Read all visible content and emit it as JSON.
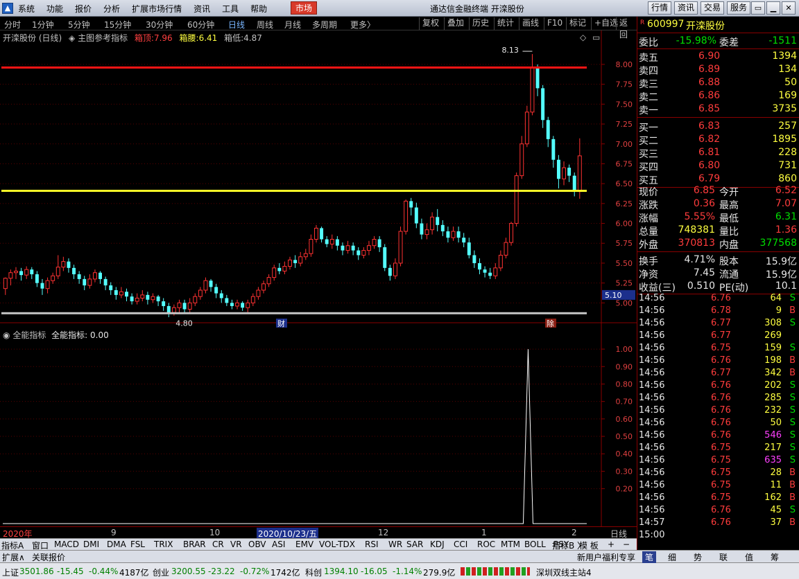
{
  "titlebar": {
    "menu": [
      "系统",
      "功能",
      "报价",
      "分析",
      "扩展市场行情",
      "资讯",
      "工具",
      "帮助"
    ],
    "market_label": "市场",
    "title": "通达信金融终端  开滦股份",
    "buttons": [
      "行情",
      "资讯",
      "交易",
      "服务"
    ]
  },
  "periodbar": {
    "periods": [
      "分时",
      "1分钟",
      "5分钟",
      "15分钟",
      "30分钟",
      "60分钟",
      "日线",
      "周线",
      "月线",
      "多周期",
      "更多〉"
    ],
    "active": "日线",
    "tools": [
      "复权",
      "叠加",
      "历史",
      "统计",
      "画线",
      "F10",
      "标记",
      "+自选",
      "返回"
    ]
  },
  "chartinfo": {
    "stock": "开滦股份 (日线)",
    "indicator": "主图参考指标",
    "top_label": "箱顶:",
    "top_value": "7.96",
    "mid_label": "箱腰:",
    "mid_value": "6.41",
    "bottom_label": "箱低:",
    "bottom_value": "4.87"
  },
  "chart_data": {
    "type": "candlestick",
    "y_axis_main": [
      "8.00",
      "7.75",
      "7.50",
      "7.25",
      "7.00",
      "6.75",
      "6.50",
      "6.25",
      "6.00",
      "5.75",
      "5.50",
      "5.25",
      "5.00"
    ],
    "ylim_main": [
      4.82,
      8.2
    ],
    "high_label": "8.13",
    "low_label": "4.80",
    "current_price_tag": "5.10",
    "box_top": 7.96,
    "box_mid": 6.41,
    "box_bottom": 4.87,
    "markers": [
      "财",
      "除"
    ],
    "candles": [
      [
        5.18,
        5.31,
        5.1,
        5.32
      ],
      [
        5.31,
        5.38,
        5.22,
        5.42
      ],
      [
        5.38,
        5.4,
        5.3,
        5.45
      ],
      [
        5.4,
        5.35,
        5.28,
        5.44
      ],
      [
        5.35,
        5.42,
        5.3,
        5.46
      ],
      [
        5.42,
        5.36,
        5.3,
        5.45
      ],
      [
        5.36,
        5.25,
        5.2,
        5.4
      ],
      [
        5.25,
        5.18,
        5.1,
        5.3
      ],
      [
        5.18,
        5.28,
        5.12,
        5.32
      ],
      [
        5.28,
        5.34,
        5.24,
        5.38
      ],
      [
        5.34,
        5.45,
        5.3,
        5.6
      ],
      [
        5.45,
        5.52,
        5.4,
        5.58
      ],
      [
        5.52,
        5.44,
        5.38,
        5.56
      ],
      [
        5.44,
        5.36,
        5.3,
        5.48
      ],
      [
        5.36,
        5.3,
        5.24,
        5.4
      ],
      [
        5.3,
        5.22,
        5.16,
        5.34
      ],
      [
        5.22,
        5.3,
        5.18,
        5.36
      ],
      [
        5.3,
        5.38,
        5.26,
        5.42
      ],
      [
        5.38,
        5.3,
        5.24,
        5.4
      ],
      [
        5.3,
        5.22,
        5.16,
        5.33
      ],
      [
        5.22,
        5.16,
        5.1,
        5.26
      ],
      [
        5.16,
        5.1,
        5.04,
        5.2
      ],
      [
        5.1,
        5.14,
        5.06,
        5.2
      ],
      [
        5.14,
        5.08,
        5.02,
        5.18
      ],
      [
        5.08,
        5.02,
        4.98,
        5.12
      ],
      [
        5.02,
        5.06,
        4.98,
        5.12
      ],
      [
        5.06,
        5.1,
        5.02,
        5.16
      ],
      [
        5.1,
        5.04,
        4.98,
        5.14
      ],
      [
        5.04,
        5.08,
        5.0,
        5.12
      ],
      [
        5.08,
        5.02,
        4.96,
        5.1
      ],
      [
        5.02,
        4.96,
        4.9,
        5.06
      ],
      [
        4.96,
        4.88,
        4.82,
        5.0
      ],
      [
        4.88,
        4.94,
        4.84,
        4.98
      ],
      [
        4.94,
        5.0,
        4.88,
        5.04
      ],
      [
        5.0,
        4.92,
        4.86,
        5.04
      ],
      [
        4.92,
        5.0,
        4.88,
        5.06
      ],
      [
        5.0,
        5.08,
        4.96,
        5.12
      ],
      [
        5.08,
        5.16,
        5.04,
        5.2
      ],
      [
        5.16,
        5.28,
        5.12,
        5.32
      ],
      [
        5.28,
        5.2,
        5.14,
        5.3
      ],
      [
        5.2,
        5.12,
        5.06,
        5.24
      ],
      [
        5.12,
        5.06,
        5.0,
        5.16
      ],
      [
        5.06,
        5.0,
        4.96,
        5.1
      ],
      [
        5.0,
        4.96,
        4.92,
        5.04
      ],
      [
        4.96,
        5.0,
        4.92,
        5.04
      ],
      [
        5.0,
        4.94,
        4.9,
        5.02
      ],
      [
        4.94,
        5.0,
        4.88,
        5.04
      ],
      [
        5.0,
        5.08,
        4.96,
        5.12
      ],
      [
        5.08,
        5.16,
        5.04,
        5.2
      ],
      [
        5.16,
        5.24,
        5.12,
        5.28
      ],
      [
        5.24,
        5.32,
        5.2,
        5.36
      ],
      [
        5.32,
        5.44,
        5.28,
        5.48
      ],
      [
        5.44,
        5.4,
        5.36,
        5.5
      ],
      [
        5.4,
        5.46,
        5.36,
        5.52
      ],
      [
        5.46,
        5.54,
        5.42,
        5.58
      ],
      [
        5.54,
        5.5,
        5.44,
        5.6
      ],
      [
        5.5,
        5.58,
        5.46,
        5.64
      ],
      [
        5.58,
        5.62,
        5.54,
        5.68
      ],
      [
        5.62,
        5.8,
        5.58,
        5.86
      ],
      [
        5.8,
        5.94,
        5.76,
        5.98
      ],
      [
        5.94,
        5.8,
        5.76,
        5.96
      ],
      [
        5.8,
        5.74,
        5.7,
        5.84
      ],
      [
        5.74,
        5.8,
        5.68,
        5.86
      ],
      [
        5.8,
        5.72,
        5.66,
        5.84
      ],
      [
        5.72,
        5.66,
        5.6,
        5.76
      ],
      [
        5.66,
        5.72,
        5.62,
        5.78
      ],
      [
        5.72,
        5.66,
        5.6,
        5.76
      ],
      [
        5.66,
        5.6,
        5.54,
        5.7
      ],
      [
        5.6,
        5.66,
        5.56,
        5.7
      ],
      [
        5.66,
        5.72,
        5.6,
        5.78
      ],
      [
        5.72,
        5.8,
        5.68,
        5.84
      ],
      [
        5.8,
        5.7,
        5.64,
        5.84
      ],
      [
        5.7,
        5.44,
        5.4,
        5.74
      ],
      [
        5.44,
        5.34,
        5.28,
        5.48
      ],
      [
        5.34,
        5.5,
        5.3,
        5.56
      ],
      [
        5.5,
        5.9,
        5.46,
        5.96
      ],
      [
        5.9,
        6.28,
        5.86,
        6.3
      ],
      [
        6.28,
        6.2,
        6.1,
        6.32
      ],
      [
        6.2,
        6.0,
        5.94,
        6.26
      ],
      [
        6.0,
        5.86,
        5.8,
        6.06
      ],
      [
        5.86,
        5.92,
        5.8,
        6.0
      ],
      [
        5.92,
        6.08,
        5.86,
        6.14
      ],
      [
        6.08,
        5.98,
        5.9,
        6.18
      ],
      [
        5.98,
        5.9,
        5.84,
        6.04
      ],
      [
        5.9,
        5.82,
        5.76,
        5.96
      ],
      [
        5.82,
        5.9,
        5.78,
        5.96
      ],
      [
        5.9,
        5.82,
        5.76,
        5.96
      ],
      [
        5.82,
        5.76,
        5.7,
        5.88
      ],
      [
        5.76,
        5.6,
        5.56,
        5.82
      ],
      [
        5.6,
        5.5,
        5.44,
        5.66
      ],
      [
        5.5,
        5.42,
        5.36,
        5.56
      ],
      [
        5.42,
        5.38,
        5.32,
        5.46
      ],
      [
        5.38,
        5.34,
        5.3,
        5.44
      ],
      [
        5.34,
        5.44,
        5.3,
        5.5
      ],
      [
        5.44,
        5.6,
        5.4,
        5.66
      ],
      [
        5.6,
        5.76,
        5.56,
        5.82
      ],
      [
        5.76,
        6.0,
        5.72,
        6.02
      ],
      [
        6.0,
        6.6,
        5.96,
        6.64
      ],
      [
        6.6,
        7.0,
        6.56,
        7.1
      ],
      [
        7.0,
        7.4,
        6.96,
        7.48
      ],
      [
        7.4,
        7.96,
        7.36,
        8.13
      ],
      [
        7.96,
        7.7,
        7.6,
        8.0
      ],
      [
        7.7,
        7.3,
        7.2,
        7.74
      ],
      [
        7.3,
        7.06,
        6.96,
        7.34
      ],
      [
        7.06,
        6.8,
        6.7,
        7.1
      ],
      [
        6.8,
        6.56,
        6.44,
        6.86
      ],
      [
        6.56,
        6.7,
        6.48,
        6.78
      ],
      [
        6.7,
        6.6,
        6.52,
        6.74
      ],
      [
        6.6,
        6.4,
        6.34,
        6.64
      ],
      [
        6.4,
        6.85,
        6.31,
        7.07
      ]
    ]
  },
  "sub_chart": {
    "indicator": "全能指标",
    "label": "全能指标:",
    "value": "0.00",
    "y_axis": [
      "1.00",
      "0.90",
      "0.80",
      "0.70",
      "0.60",
      "0.50",
      "0.40",
      "0.30",
      "0.20"
    ]
  },
  "date_axis": [
    "2020年",
    "9",
    "10",
    "2020/10/23/五",
    "12",
    "1",
    "2",
    "日线"
  ],
  "right": {
    "flag": "R",
    "code": "600997",
    "name": "开滦股份",
    "weibi_label": "委比",
    "weibi": "-15.98%",
    "weicha_label": "委差",
    "weicha": "-1511",
    "sells": [
      {
        "label": "卖五",
        "price": "6.90",
        "vol": "1394"
      },
      {
        "label": "卖四",
        "price": "6.89",
        "vol": "134"
      },
      {
        "label": "卖三",
        "price": "6.88",
        "vol": "50"
      },
      {
        "label": "卖二",
        "price": "6.86",
        "vol": "169"
      },
      {
        "label": "卖一",
        "price": "6.85",
        "vol": "3735"
      }
    ],
    "buys": [
      {
        "label": "买一",
        "price": "6.83",
        "vol": "257"
      },
      {
        "label": "买二",
        "price": "6.82",
        "vol": "1895"
      },
      {
        "label": "买三",
        "price": "6.81",
        "vol": "228"
      },
      {
        "label": "买四",
        "price": "6.80",
        "vol": "731"
      },
      {
        "label": "买五",
        "price": "6.79",
        "vol": "860"
      }
    ],
    "stats": [
      {
        "l1": "现价",
        "v1": "6.85",
        "l2": "今开",
        "v2": "6.52",
        "c1": "red",
        "c2": "red"
      },
      {
        "l1": "涨跌",
        "v1": "0.36",
        "l2": "最高",
        "v2": "7.07",
        "c1": "red",
        "c2": "red"
      },
      {
        "l1": "涨幅",
        "v1": "5.55%",
        "l2": "最低",
        "v2": "6.31",
        "c1": "red",
        "c2": "green"
      },
      {
        "l1": "总量",
        "v1": "748381",
        "l2": "量比",
        "v2": "1.36",
        "c1": "yellow",
        "c2": "red"
      },
      {
        "l1": "外盘",
        "v1": "370813",
        "l2": "内盘",
        "v2": "377568",
        "c1": "red",
        "c2": "green"
      }
    ],
    "stats2": [
      {
        "l1": "换手",
        "v1": "4.71%",
        "l2": "股本",
        "v2": "15.9亿"
      },
      {
        "l1": "净资",
        "v1": "7.45",
        "l2": "流通",
        "v2": "15.9亿"
      },
      {
        "l1": "收益(三)",
        "v1": "0.510",
        "l2": "PE(动)",
        "v2": "10.1"
      }
    ],
    "ticks": [
      {
        "t": "14:56",
        "p": "6.76",
        "v": "64",
        "s": "S",
        "vc": "yellow"
      },
      {
        "t": "14:56",
        "p": "6.78",
        "v": "9",
        "s": "B",
        "vc": "yellow"
      },
      {
        "t": "14:56",
        "p": "6.77",
        "v": "308",
        "s": "S",
        "vc": "yellow"
      },
      {
        "t": "14:56",
        "p": "6.77",
        "v": "269",
        "s": "",
        "vc": "yellow"
      },
      {
        "t": "14:56",
        "p": "6.75",
        "v": "159",
        "s": "S",
        "vc": "yellow"
      },
      {
        "t": "14:56",
        "p": "6.76",
        "v": "198",
        "s": "B",
        "vc": "yellow"
      },
      {
        "t": "14:56",
        "p": "6.77",
        "v": "342",
        "s": "B",
        "vc": "yellow"
      },
      {
        "t": "14:56",
        "p": "6.76",
        "v": "202",
        "s": "S",
        "vc": "yellow"
      },
      {
        "t": "14:56",
        "p": "6.76",
        "v": "285",
        "s": "S",
        "vc": "yellow"
      },
      {
        "t": "14:56",
        "p": "6.76",
        "v": "232",
        "s": "S",
        "vc": "yellow"
      },
      {
        "t": "14:56",
        "p": "6.76",
        "v": "50",
        "s": "S",
        "vc": "yellow"
      },
      {
        "t": "14:56",
        "p": "6.76",
        "v": "546",
        "s": "S",
        "vc": "purple"
      },
      {
        "t": "14:56",
        "p": "6.75",
        "v": "217",
        "s": "S",
        "vc": "yellow"
      },
      {
        "t": "14:56",
        "p": "6.75",
        "v": "635",
        "s": "S",
        "vc": "purple"
      },
      {
        "t": "14:56",
        "p": "6.75",
        "v": "28",
        "s": "B",
        "vc": "yellow"
      },
      {
        "t": "14:56",
        "p": "6.75",
        "v": "11",
        "s": "B",
        "vc": "yellow"
      },
      {
        "t": "14:56",
        "p": "6.75",
        "v": "162",
        "s": "B",
        "vc": "yellow"
      },
      {
        "t": "14:56",
        "p": "6.76",
        "v": "45",
        "s": "S",
        "vc": "yellow"
      },
      {
        "t": "14:57",
        "p": "6.76",
        "v": "37",
        "s": "B",
        "vc": "yellow"
      },
      {
        "t": "15:00",
        "p": "",
        "v": "",
        "s": "",
        "vc": "yellow"
      }
    ]
  },
  "indicator_tabs": [
    "指标A",
    "窗口",
    "MACD",
    "DMI",
    "DMA",
    "FSL",
    "TRIX",
    "BRAR",
    "CR",
    "VR",
    "OBV",
    "ASI",
    "EMV",
    "VOL-TDX",
    "RSI",
    "WR",
    "SAR",
    "KDJ",
    "CCI",
    "ROC",
    "MTM",
    "BOLL",
    "PSY",
    "〉",
    "指标B",
    "模 板",
    "+",
    "−"
  ],
  "ext_tabs": [
    "扩展∧",
    "关联报价"
  ],
  "ext_right": "新用户福利专享",
  "ext_right_tabs": [
    "笔",
    "细",
    "势",
    "联",
    "值",
    "筹"
  ],
  "status": [
    {
      "name": "上证",
      "val": "3501.86",
      "chg": "-15.45",
      "pct": "-0.44%",
      "amt": "4187亿"
    },
    {
      "name": "创业",
      "val": "3200.55",
      "chg": "-23.22",
      "pct": "-0.72%",
      "amt": "1742亿"
    },
    {
      "name": "科创",
      "val": "1394.10",
      "chg": "-16.05",
      "pct": "-1.14%",
      "amt": "279.9亿"
    }
  ],
  "station": "深圳双线主站4"
}
